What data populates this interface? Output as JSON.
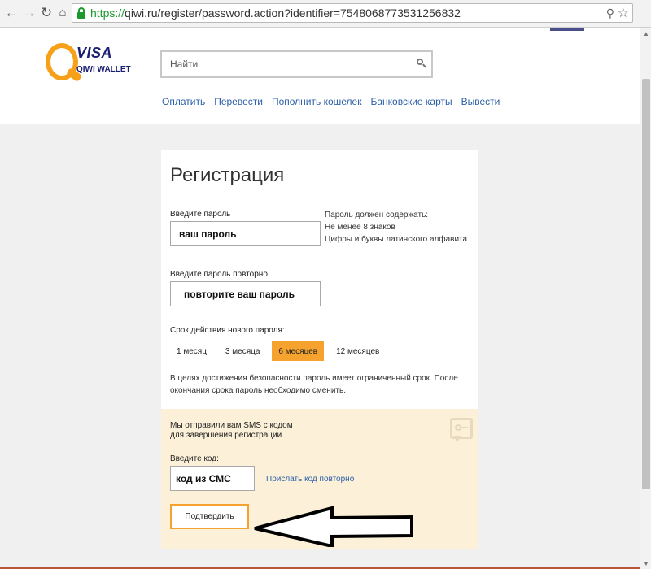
{
  "browser": {
    "back_icon": "back-arrow-icon",
    "forward_icon": "forward-arrow-icon",
    "reload_icon": "reload-icon",
    "home_icon": "home-icon",
    "url_scheme": "https://",
    "url_rest": "qiwi.ru/register/password.action?identifier=7548068773531256832",
    "https_color": "#1a9a2e"
  },
  "header": {
    "logo_brand": "VISA",
    "logo_sub": "QIWI WALLET",
    "search_placeholder": "Найти",
    "nav": [
      "Оплатить",
      "Перевести",
      "Пополнить кошелек",
      "Банковские карты",
      "Вывести"
    ]
  },
  "form": {
    "title": "Регистрация",
    "password_label": "Введите пароль",
    "password_value": "ваш пароль",
    "password_hint": [
      "Пароль должен содержать:",
      "Не менее 8 знаков",
      "Цифры и буквы латинского алфавита"
    ],
    "repeat_label": "Введите пароль повторно",
    "repeat_value": "повторите ваш пароль",
    "period_label": "Срок действия нового пароля:",
    "periods": [
      "1 месяц",
      "3 месяца",
      "6 месяцев",
      "12 месяцев"
    ],
    "active_period_index": 2,
    "note": "В целях достижения безопасности пароль имеет ограниченный срок. После окончания срока пароль необходимо сменить."
  },
  "sms": {
    "message": "Мы отправили вам SMS с кодом для завершения регистрации",
    "code_label": "Введите код:",
    "code_value": "код из СМС",
    "resend_link": "Прислать код повторно",
    "confirm_button": "Подтвердить"
  },
  "colors": {
    "accent": "#f5a32e",
    "link": "#2a5ea8",
    "panel": "#fcf1d8",
    "brand_blue": "#1a1f71",
    "brand_orange": "#f7a11a"
  }
}
